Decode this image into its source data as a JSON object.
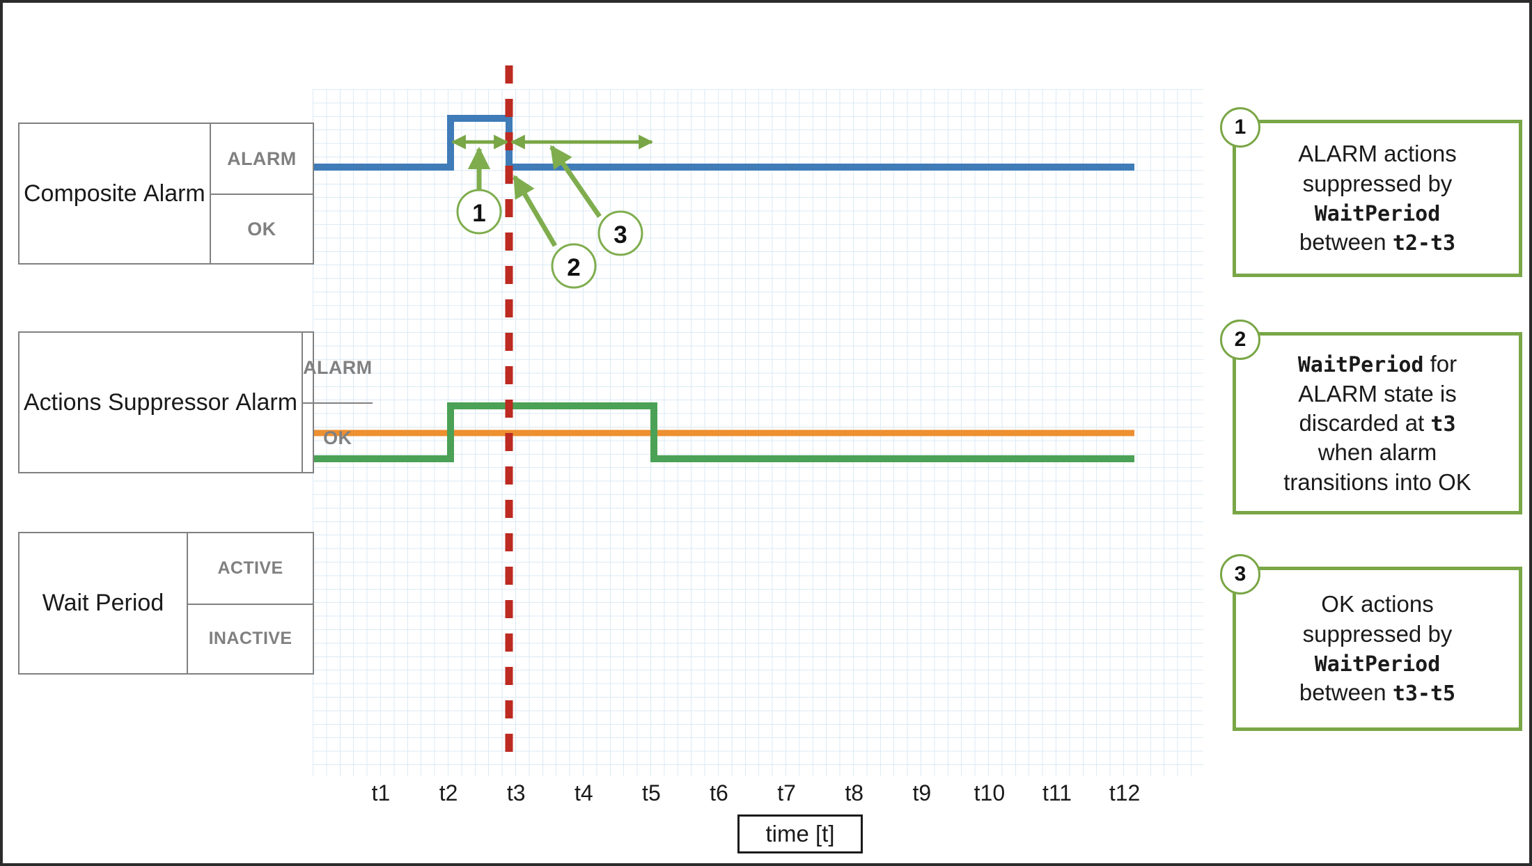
{
  "colors": {
    "composite_alarm_trace": "#3f7cb8",
    "suppressor_alarm_trace": "#ed9030",
    "wait_period_trace": "#4ba155",
    "marker_line": "#bc2a22",
    "annotation_green": "#79a646",
    "grid_minor": "#dbeaf5",
    "grid_major": "#cfe2f1",
    "box_border": "#808080",
    "page_border": "#2b2b2b"
  },
  "rows": [
    {
      "name": "Composite\nAlarm",
      "name_lines": [
        "Composite",
        "Alarm"
      ],
      "state_high": "ALARM",
      "state_low": "OK"
    },
    {
      "name": "Actions\nSuppressor\nAlarm",
      "name_lines": [
        "Actions",
        "Suppressor",
        "Alarm"
      ],
      "state_high": "ALARM",
      "state_low": "OK"
    },
    {
      "name": "Wait\nPeriod",
      "name_lines": [
        "Wait",
        "Period"
      ],
      "state_high": "ACTIVE",
      "state_low": "INACTIVE"
    }
  ],
  "axis": {
    "title": "time [t]",
    "ticks": [
      "t1",
      "t2",
      "t3",
      "t4",
      "t5",
      "t6",
      "t7",
      "t8",
      "t9",
      "t10",
      "t11",
      "t12"
    ]
  },
  "marker": {
    "at_tick": "t3",
    "style": "dashed-vertical"
  },
  "spans": [
    {
      "id": "span-1",
      "from": "t2",
      "to": "t3",
      "label_ref": "1"
    },
    {
      "id": "span-2",
      "from": "t3",
      "to": "t5",
      "label_ref": "3"
    }
  ],
  "callouts": [
    {
      "number": "1",
      "text": "ALARM actions suppressed by WaitPeriod between t2-t3",
      "lines": [
        [
          {
            "t": "ALARM actions",
            "m": false
          }
        ],
        [
          {
            "t": "suppressed by",
            "m": false
          }
        ],
        [
          {
            "t": "WaitPeriod",
            "m": true
          }
        ],
        [
          {
            "t": "between ",
            "m": false
          },
          {
            "t": "t2-t3",
            "m": true
          }
        ]
      ]
    },
    {
      "number": "2",
      "text": "WaitPeriod for ALARM state is discarded at t3 when alarm transitions into OK",
      "lines": [
        [
          {
            "t": "WaitPeriod",
            "m": true
          },
          {
            "t": " for",
            "m": false
          }
        ],
        [
          {
            "t": "ALARM state is",
            "m": false
          }
        ],
        [
          {
            "t": "discarded at ",
            "m": false
          },
          {
            "t": "t3",
            "m": true
          }
        ],
        [
          {
            "t": "when alarm",
            "m": false
          }
        ],
        [
          {
            "t": "transitions into OK",
            "m": false
          }
        ]
      ]
    },
    {
      "number": "3",
      "text": "OK actions suppressed by WaitPeriod between t3-t5",
      "lines": [
        [
          {
            "t": "OK actions",
            "m": false
          }
        ],
        [
          {
            "t": "suppressed by",
            "m": false
          }
        ],
        [
          {
            "t": "WaitPeriod",
            "m": true
          }
        ],
        [
          {
            "t": "between ",
            "m": false
          },
          {
            "t": "t3-t5",
            "m": true
          }
        ]
      ]
    }
  ],
  "chart_data": {
    "type": "line",
    "title": "",
    "xlabel": "time [t]",
    "ylabel": "",
    "grid": true,
    "legend": "none",
    "x": [
      "t1",
      "t2",
      "t3",
      "t4",
      "t5",
      "t6",
      "t7",
      "t8",
      "t9",
      "t10",
      "t11",
      "t12"
    ],
    "series": [
      {
        "name": "Composite Alarm",
        "color": "#3f7cb8",
        "states": [
          "OK",
          "ALARM"
        ],
        "values": [
          "OK",
          "ALARM",
          "OK",
          "OK",
          "OK",
          "OK",
          "OK",
          "OK",
          "OK",
          "OK",
          "OK",
          "OK"
        ],
        "transitions": [
          {
            "at": "t2",
            "to": "ALARM"
          },
          {
            "at": "t3",
            "to": "OK"
          }
        ]
      },
      {
        "name": "Actions Suppressor Alarm",
        "color": "#ed9030",
        "states": [
          "OK",
          "ALARM"
        ],
        "values": [
          "OK",
          "OK",
          "OK",
          "OK",
          "OK",
          "OK",
          "OK",
          "OK",
          "OK",
          "OK",
          "OK",
          "OK"
        ],
        "transitions": []
      },
      {
        "name": "Wait Period",
        "color": "#4ba155",
        "states": [
          "INACTIVE",
          "ACTIVE"
        ],
        "values": [
          "INACTIVE",
          "ACTIVE",
          "ACTIVE",
          "ACTIVE",
          "INACTIVE",
          "INACTIVE",
          "INACTIVE",
          "INACTIVE",
          "INACTIVE",
          "INACTIVE",
          "INACTIVE",
          "INACTIVE"
        ],
        "transitions": [
          {
            "at": "t2",
            "to": "ACTIVE"
          },
          {
            "at": "t5",
            "to": "INACTIVE"
          }
        ]
      }
    ],
    "annotations": [
      {
        "ref": "1",
        "span": [
          "t2",
          "t3"
        ],
        "note": "ALARM actions suppressed by WaitPeriod between t2-t3"
      },
      {
        "ref": "2",
        "at": "t3",
        "note": "WaitPeriod for ALARM state is discarded at t3 when alarm transitions into OK"
      },
      {
        "ref": "3",
        "span": [
          "t3",
          "t5"
        ],
        "note": "OK actions suppressed by WaitPeriod between t3-t5"
      }
    ],
    "marker_lines": [
      {
        "at": "t3",
        "color": "#bc2a22",
        "style": "dashed"
      }
    ]
  }
}
